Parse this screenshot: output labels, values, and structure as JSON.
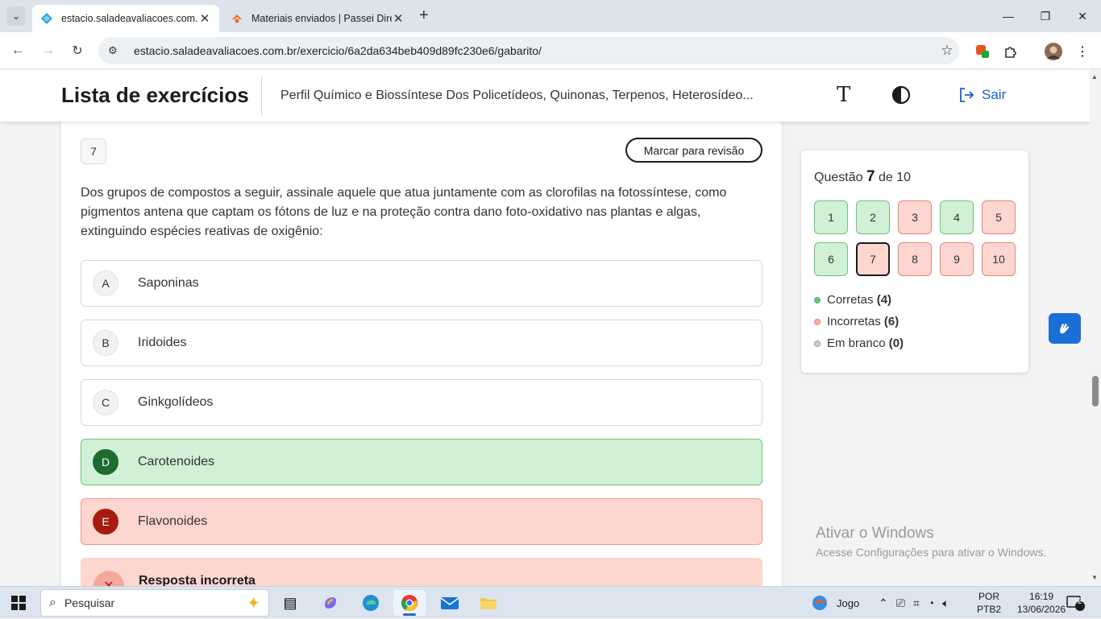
{
  "browser": {
    "tabs": [
      {
        "title": "estacio.saladeavaliacoes.com.br",
        "active": true
      },
      {
        "title": "Materiais enviados | Passei Direto",
        "active": false
      }
    ],
    "url": "estacio.saladeavaliacoes.com.br/exercicio/6a2da634beb409d89fc230e6/gabarito/"
  },
  "header": {
    "title": "Lista de exercícios",
    "subtitle": "Perfil Químico e Biossíntese Dos Policetídeos, Quinonas, Terpenos, Heterosídeo...",
    "font_button": "T",
    "exit_label": "Sair"
  },
  "question": {
    "number": "7",
    "review_button": "Marcar para revisão",
    "text": "Dos grupos de compostos a seguir, assinale aquele que atua juntamente com as clorofilas na fotossíntese, como pigmentos antena que captam os fótons de luz e na proteção contra dano foto-oxidativo nas plantas e algas, extinguindo espécies reativas de oxigênio:",
    "options": [
      {
        "letter": "A",
        "text": "Saponinas",
        "state": "neutral"
      },
      {
        "letter": "B",
        "text": "Iridoides",
        "state": "neutral"
      },
      {
        "letter": "C",
        "text": "Ginkgolídeos",
        "state": "neutral"
      },
      {
        "letter": "D",
        "text": "Carotenoides",
        "state": "correct"
      },
      {
        "letter": "E",
        "text": "Flavonoides",
        "state": "wrong"
      }
    ],
    "result_label": "Resposta incorreta"
  },
  "sidebar": {
    "label_prefix": "Questão",
    "current": "7",
    "label_suffix": "de 10",
    "questions": [
      {
        "n": "1",
        "status": "ok"
      },
      {
        "n": "2",
        "status": "ok"
      },
      {
        "n": "3",
        "status": "bad"
      },
      {
        "n": "4",
        "status": "ok"
      },
      {
        "n": "5",
        "status": "bad"
      },
      {
        "n": "6",
        "status": "ok"
      },
      {
        "n": "7",
        "status": "bad",
        "current": true
      },
      {
        "n": "8",
        "status": "bad"
      },
      {
        "n": "9",
        "status": "bad"
      },
      {
        "n": "10",
        "status": "bad"
      }
    ],
    "legend": [
      {
        "label": "Corretas",
        "count": "(4)",
        "color": "#6cc47c"
      },
      {
        "label": "Incorretas",
        "count": "(6)",
        "color": "#f09a8a"
      },
      {
        "label": "Em branco",
        "count": "(0)",
        "color": "#b5b5b5"
      }
    ]
  },
  "watermark": {
    "line1": "Ativar o Windows",
    "line2": "Acesse Configurações para ativar o Windows."
  },
  "taskbar": {
    "search_placeholder": "Pesquisar",
    "game_label": "Jogo",
    "lang_line1": "POR",
    "lang_line2": "PTB2",
    "time": "16:19",
    "date": "13/06/2026",
    "notifications": "2"
  }
}
